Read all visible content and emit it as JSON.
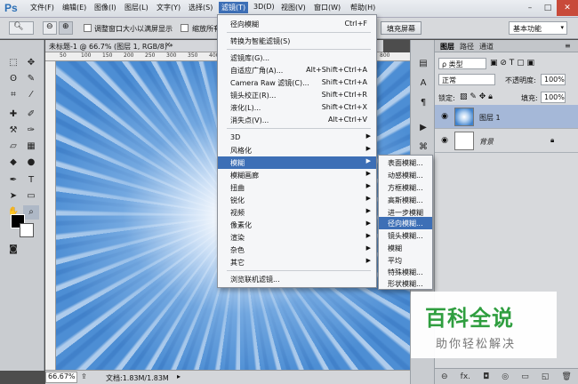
{
  "app": {
    "logo": "Ps"
  },
  "menubar": {
    "items": [
      {
        "label": "文件(F)"
      },
      {
        "label": "编辑(E)"
      },
      {
        "label": "图像(I)"
      },
      {
        "label": "图层(L)"
      },
      {
        "label": "文字(Y)"
      },
      {
        "label": "选择(S)"
      },
      {
        "label": "滤镜(T)"
      },
      {
        "label": "3D(D)"
      },
      {
        "label": "视图(V)"
      },
      {
        "label": "窗口(W)"
      },
      {
        "label": "帮助(H)"
      }
    ],
    "active_index": 6,
    "window_controls": [
      "–",
      "□",
      "✕"
    ]
  },
  "options_bar": {
    "checkbox1_label": "调整窗口大小以满屏显示",
    "checkbox2_label": "缩放所有",
    "fill_screen_button": "填充屏幕",
    "workspace": "基本功能"
  },
  "document": {
    "tab_label": "未标题-1 @ 66.7% (图层 1, RGB/8) *",
    "ruler_ticks": [
      "50",
      "100",
      "150",
      "200",
      "250",
      "300",
      "350",
      "400",
      "450",
      "500",
      "550",
      "600",
      "650",
      "700",
      "750",
      "800"
    ]
  },
  "status_bar": {
    "zoom": "66.67%",
    "doc_info": "文档:1.83M/1.83M"
  },
  "filter_menu": {
    "groups": [
      [
        {
          "label": "径向模糊",
          "shortcut": "Ctrl+F"
        }
      ],
      [
        {
          "label": "转换为智能滤镜(S)"
        }
      ],
      [
        {
          "label": "滤镜库(G)..."
        },
        {
          "label": "自适应广角(A)...",
          "shortcut": "Alt+Shift+Ctrl+A"
        },
        {
          "label": "Camera Raw 滤镜(C)...",
          "shortcut": "Shift+Ctrl+A"
        },
        {
          "label": "镜头校正(R)...",
          "shortcut": "Shift+Ctrl+R"
        },
        {
          "label": "液化(L)...",
          "shortcut": "Shift+Ctrl+X"
        },
        {
          "label": "消失点(V)...",
          "shortcut": "Alt+Ctrl+V"
        }
      ],
      [
        {
          "label": "3D",
          "submenu": true
        },
        {
          "label": "风格化",
          "submenu": true
        },
        {
          "label": "模糊",
          "submenu": true,
          "highlighted": true
        },
        {
          "label": "模糊画廊",
          "submenu": true
        },
        {
          "label": "扭曲",
          "submenu": true
        },
        {
          "label": "锐化",
          "submenu": true
        },
        {
          "label": "视频",
          "submenu": true
        },
        {
          "label": "像素化",
          "submenu": true
        },
        {
          "label": "渲染",
          "submenu": true
        },
        {
          "label": "杂色",
          "submenu": true
        },
        {
          "label": "其它",
          "submenu": true
        }
      ],
      [
        {
          "label": "浏览联机滤镜..."
        }
      ]
    ]
  },
  "blur_submenu": {
    "items": [
      {
        "label": "表面模糊..."
      },
      {
        "label": "动感模糊..."
      },
      {
        "label": "方框模糊..."
      },
      {
        "label": "高斯模糊..."
      },
      {
        "label": "进一步模糊"
      },
      {
        "label": "径向模糊...",
        "highlighted": true
      },
      {
        "label": "镜头模糊..."
      },
      {
        "label": "模糊"
      },
      {
        "label": "平均"
      },
      {
        "label": "特殊模糊..."
      },
      {
        "label": "形状模糊..."
      }
    ]
  },
  "layers_panel": {
    "tabs": [
      "图层",
      "路径",
      "通道"
    ],
    "filter_kind": "ρ 类型",
    "blend_mode": "正常",
    "opacity_label": "不透明度:",
    "opacity_value": "100%",
    "lock_label": "锁定:",
    "fill_label": "填充:",
    "fill_value": "100%",
    "layers": [
      {
        "name": "图层 1",
        "selected": true
      },
      {
        "name": "背景",
        "locked": true
      }
    ],
    "bottom_icons": [
      "⊖",
      "fx.",
      "◘",
      "◎",
      "▭",
      "◱",
      "🗑"
    ]
  },
  "watermark": {
    "title": "百科全说",
    "subtitle": "助你轻松解决"
  },
  "colors": {
    "accent": "#3d6fb6",
    "watermark_green": "#2f9e3f",
    "canvas_blue": "#4d8ed4"
  }
}
